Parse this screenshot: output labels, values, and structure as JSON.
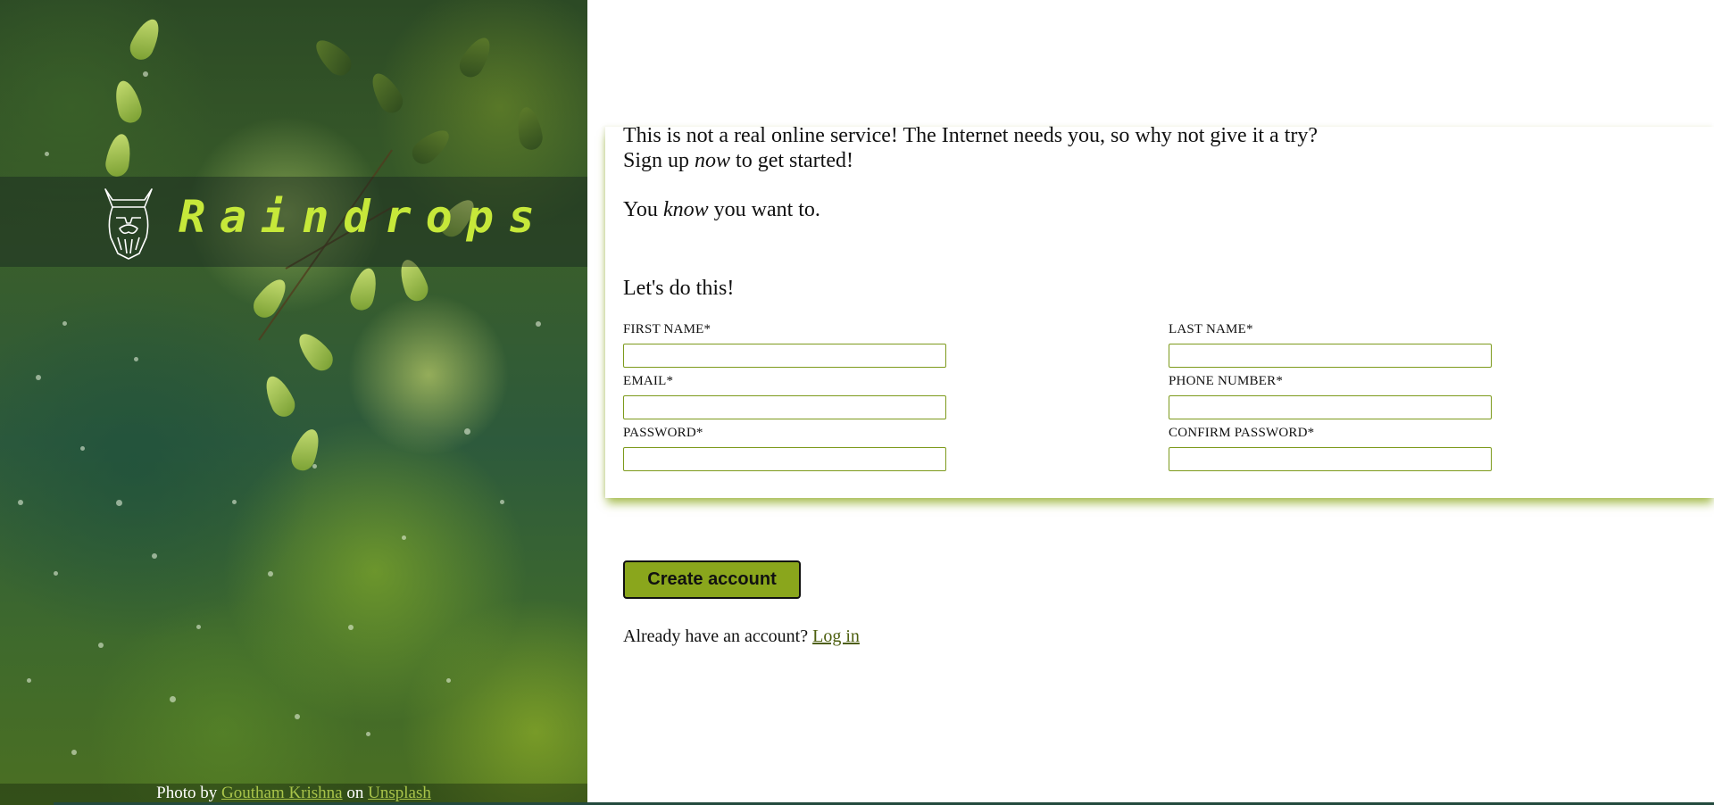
{
  "brand": {
    "name": "Raindrops",
    "accent_color": "#c6e83a"
  },
  "credit": {
    "prefix": "Photo by",
    "author": "Goutham Krishna",
    "middle": "on",
    "site": "Unsplash"
  },
  "intro": {
    "line1": "This is not a real online service! The Internet needs you, so why not give it a try?",
    "line2_pre": "Sign up",
    "line2_em": "now",
    "line2_post": "to get started!",
    "line3_pre": "You",
    "line3_em": "know",
    "line3_post": "you want to."
  },
  "form": {
    "heading": "Let's do this!",
    "fields": {
      "first_name": {
        "label": "FIRST NAME*",
        "value": ""
      },
      "last_name": {
        "label": "LAST NAME*",
        "value": ""
      },
      "email": {
        "label": "EMAIL*",
        "value": ""
      },
      "phone": {
        "label": "PHONE NUMBER*",
        "value": ""
      },
      "password": {
        "label": "PASSWORD*",
        "value": ""
      },
      "confirm_password": {
        "label": "CONFIRM PASSWORD*",
        "value": ""
      }
    },
    "border_color": "#7d9a1c"
  },
  "actions": {
    "create_label": "Create account",
    "create_color": "#8aa61c",
    "login_prompt": "Already have an account?",
    "login_link": "Log in"
  }
}
